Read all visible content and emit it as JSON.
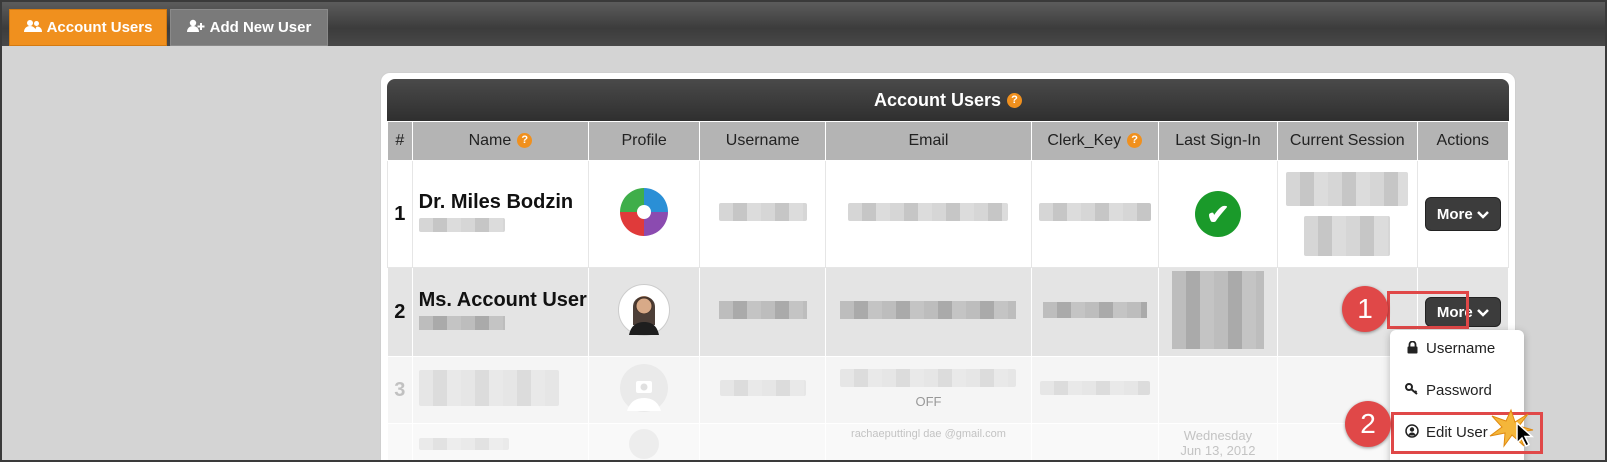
{
  "tabs": [
    {
      "label": "Account Users",
      "icon": "users-icon",
      "active": true
    },
    {
      "label": "Add New User",
      "icon": "user-plus-icon",
      "active": false
    }
  ],
  "panel": {
    "title": "Account Users",
    "help_glyph": "?"
  },
  "columns": [
    "#",
    "Name",
    "Profile",
    "Username",
    "Email",
    "Clerk_Key",
    "Last Sign-In",
    "Current Session",
    "Actions"
  ],
  "rows": [
    {
      "num": "1",
      "name": "Dr. Miles Bodzin",
      "more_label": "More"
    },
    {
      "num": "2",
      "name": "Ms. Account User",
      "more_label": "More"
    },
    {
      "num": "3",
      "email_status": "OFF"
    },
    {
      "last_signin_line1": "Wednesday",
      "last_signin_line2": "Jun 13, 2012",
      "email_partial": "rachaeputtingl dae @gmail.com"
    }
  ],
  "dropdown": {
    "items": [
      {
        "label": "Username",
        "icon": "lock-icon"
      },
      {
        "label": "Password",
        "icon": "key-icon"
      },
      {
        "label": "Edit User",
        "icon": "user-circle-icon"
      }
    ]
  },
  "callouts": [
    "1",
    "2"
  ],
  "colors": {
    "accent": "#f0901e",
    "callout": "#e04848",
    "check": "#1a9a2a",
    "header_dark": "#3c3c3c"
  }
}
